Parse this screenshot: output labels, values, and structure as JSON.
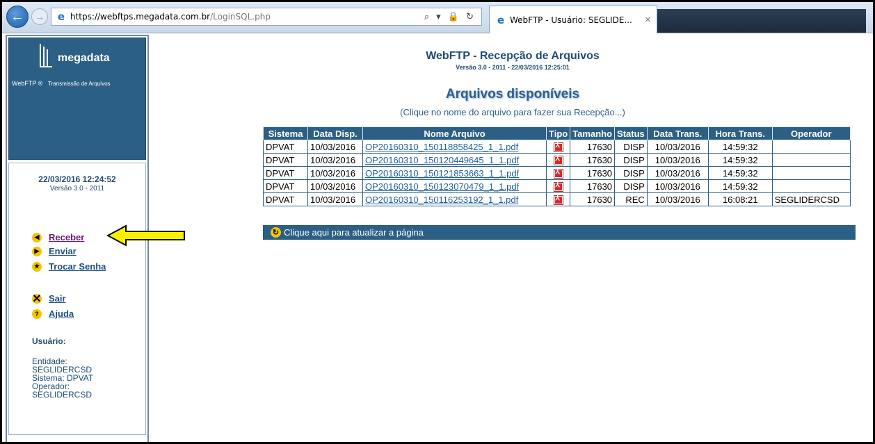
{
  "browser": {
    "url_host": "https://webftps.megadata.com.br",
    "url_path": "/LoginSQL.php",
    "tab_title": "WebFTP - Usuário: SEGLIDE...",
    "address_tools": "⌕ ▾ 🔒 ↻",
    "tab_close": "✕"
  },
  "sidebar": {
    "logo_name": "megadata",
    "tagline_product": "WebFTP ®",
    "tagline_desc": "Transmissão de Arquivos",
    "datetime": "22/03/2016 12:24:52",
    "version": "Versão 3.0 - 2011",
    "menu": [
      {
        "label": "Receber",
        "icon": "arrow-left-icon"
      },
      {
        "label": "Enviar",
        "icon": "arrow-right-icon"
      },
      {
        "label": "Trocar Senha",
        "icon": "star-icon"
      },
      {
        "label": "Sair",
        "icon": "exit-icon"
      },
      {
        "label": "Ajuda",
        "icon": "help-icon"
      }
    ],
    "user_heading": "Usuário:",
    "user_lines": [
      "Entidade:",
      "SEGLIDERCSD",
      "Sistema: DPVAT",
      "Operador:",
      "SEGLIDERCSD"
    ]
  },
  "main": {
    "title": "WebFTP - Recepção de Arquivos",
    "subtitle": "Versão 3.0 - 2011 - 22/03/2016 12:25:01",
    "heading": "Arquivos disponíveis",
    "hint": "(Clique no nome do arquivo para fazer sua Recepção...)",
    "columns": [
      "Sistema",
      "Data Disp.",
      "Nome Arquivo",
      "Tipo",
      "Tamanho",
      "Status",
      "Data Trans.",
      "Hora Trans.",
      "Operador"
    ],
    "rows": [
      [
        "DPVAT",
        "10/03/2016",
        "OP20160310_150118858425_1_1.pdf",
        "pdf",
        "17630",
        "DISP",
        "10/03/2016",
        "14:59:32",
        ""
      ],
      [
        "DPVAT",
        "10/03/2016",
        "OP20160310_150120449645_1_1.pdf",
        "pdf",
        "17630",
        "DISP",
        "10/03/2016",
        "14:59:32",
        ""
      ],
      [
        "DPVAT",
        "10/03/2016",
        "OP20160310_150121853663_1_1.pdf",
        "pdf",
        "17630",
        "DISP",
        "10/03/2016",
        "14:59:32",
        ""
      ],
      [
        "DPVAT",
        "10/03/2016",
        "OP20160310_150123070479_1_1.pdf",
        "pdf",
        "17630",
        "DISP",
        "10/03/2016",
        "14:59:32",
        ""
      ],
      [
        "DPVAT",
        "10/03/2016",
        "OP20160310_150116253192_1_1.pdf",
        "pdf",
        "17630",
        "REC",
        "10/03/2016",
        "16:08:21",
        "SEGLIDERCSD"
      ]
    ],
    "refresh_label": "Clique aqui para atualizar a página"
  },
  "colors": {
    "header_blue": "#2c5f86",
    "link_blue": "#1f5fa0",
    "annotation_arrow": "#f7f000"
  }
}
